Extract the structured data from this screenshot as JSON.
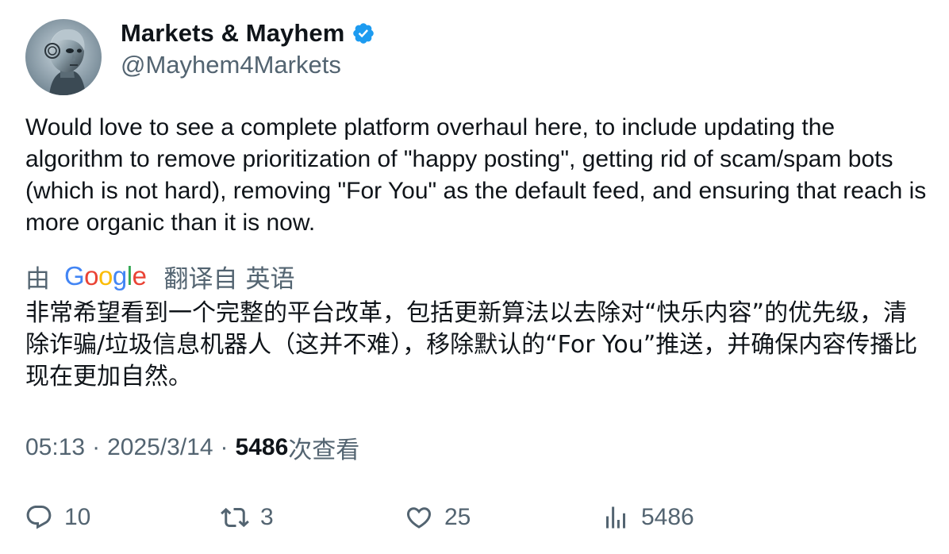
{
  "author": {
    "display_name": "Markets & Mayhem",
    "handle": "@Mayhem4Markets",
    "verified": true,
    "avatar": "robot-avatar",
    "verified_color": "#1d9bf0"
  },
  "tweet": {
    "text": "Would love to see a complete platform overhaul here, to include updating the algorithm to remove prioritization of \"happy posting\", getting rid of scam/spam bots (which is not hard), removing \"For You\" as the default feed, and ensuring that reach is more organic than it is now."
  },
  "translation": {
    "by_label": "由",
    "provider": "Google",
    "from_label": "翻译自",
    "language": "英语",
    "text": "非常希望看到一个完整的平台改革，包括更新算法以去除对“快乐内容”的优先级，清除诈骗/垃圾信息机器人（这并不难），移除默认的“For You”推送，并确保内容传播比现在更加自然。"
  },
  "meta": {
    "time": "05:13",
    "separator": "·",
    "date": "2025/3/14",
    "views_count": "5486",
    "views_label": "次查看"
  },
  "actions": {
    "replies": "10",
    "retweets": "3",
    "likes": "25",
    "views": "5486"
  },
  "colors": {
    "text": "#0f1419",
    "secondary": "#536471",
    "verified": "#1d9bf0"
  }
}
